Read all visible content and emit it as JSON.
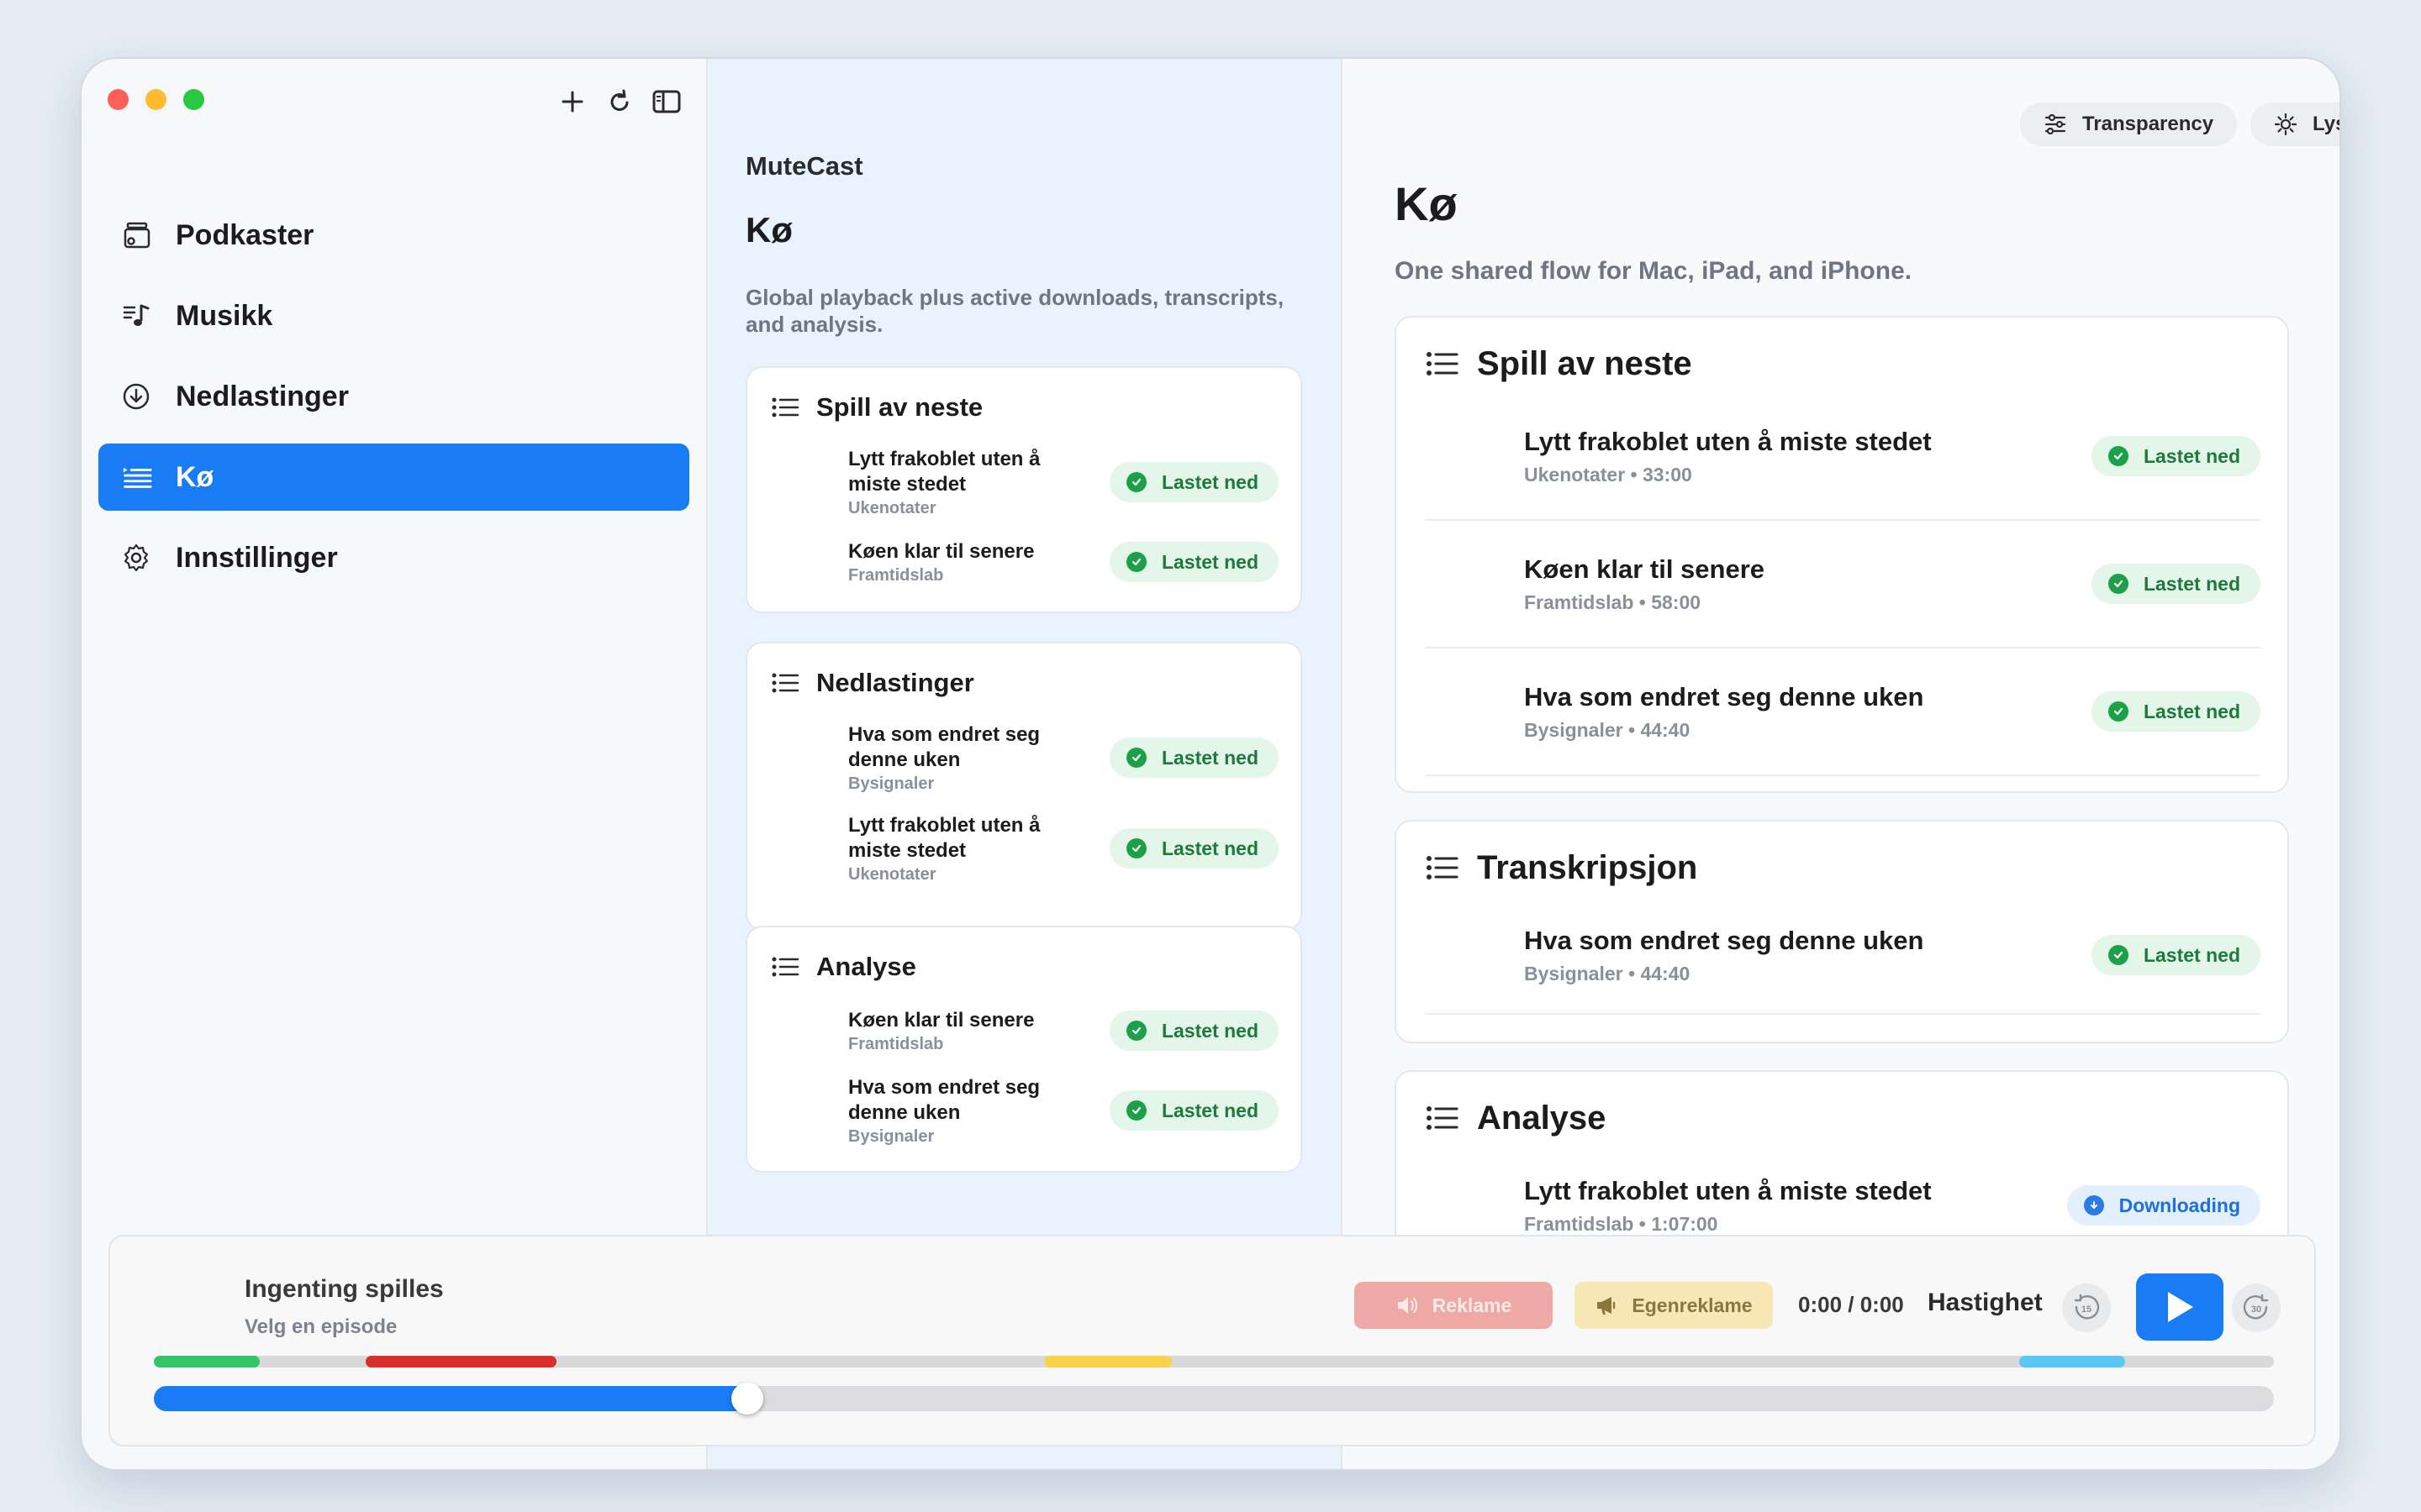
{
  "sidebar": {
    "items": [
      {
        "label": "Podkaster",
        "icon": "podcasts-icon"
      },
      {
        "label": "Musikk",
        "icon": "music-icon"
      },
      {
        "label": "Nedlastinger",
        "icon": "download-icon"
      },
      {
        "label": "Kø",
        "icon": "queue-icon",
        "active": true
      },
      {
        "label": "Innstillinger",
        "icon": "gear-icon"
      }
    ]
  },
  "middle": {
    "app_name": "MuteCast",
    "title": "Kø",
    "subtitle": "Global playback plus active downloads, transcripts, and analysis.",
    "sections": [
      {
        "title": "Spill av neste",
        "rows": [
          {
            "title": "Lytt frakoblet uten å miste stedet",
            "sub": "Ukenotater",
            "badge": "Lastet ned"
          },
          {
            "title": "Køen klar til senere",
            "sub": "Framtidslab",
            "badge": "Lastet ned"
          }
        ]
      },
      {
        "title": "Nedlastinger",
        "rows": [
          {
            "title": "Hva som endret seg denne uken",
            "sub": "Bysignaler",
            "badge": "Lastet ned"
          },
          {
            "title": "Lytt frakoblet uten å miste stedet",
            "sub": "Ukenotater",
            "badge": "Lastet ned"
          }
        ]
      },
      {
        "title": "Analyse",
        "rows": [
          {
            "title": "Køen klar til senere",
            "sub": "Framtidslab",
            "badge": "Lastet ned"
          },
          {
            "title": "Hva som endret seg denne uken",
            "sub": "Bysignaler",
            "badge": "Lastet ned"
          }
        ]
      }
    ]
  },
  "right": {
    "transparency_label": "Transparency",
    "theme_label": "Lyst",
    "title": "Kø",
    "subtitle": "One shared flow for Mac, iPad, and iPhone.",
    "sections": [
      {
        "title": "Spill av neste",
        "rows": [
          {
            "title": "Lytt frakoblet uten å miste stedet",
            "sub": "Ukenotater • 33:00",
            "badge": "Lastet ned"
          },
          {
            "title": "Køen klar til senere",
            "sub": "Framtidslab • 58:00",
            "badge": "Lastet ned"
          },
          {
            "title": "Hva som endret seg denne uken",
            "sub": "Bysignaler • 44:40",
            "badge": "Lastet ned"
          }
        ]
      },
      {
        "title": "Transkripsjon",
        "rows": [
          {
            "title": "Hva som endret seg denne uken",
            "sub": "Bysignaler • 44:40",
            "badge": "Lastet ned"
          }
        ]
      },
      {
        "title": "Analyse",
        "rows": [
          {
            "title": "Lytt frakoblet uten å miste stedet",
            "sub": "Framtidslab • 1:07:00",
            "badge": "Downloading"
          }
        ]
      }
    ]
  },
  "player": {
    "title": "Ingenting spilles",
    "subtitle": "Velg en episode",
    "ad_label": "Reklame",
    "self_promo_label": "Egenreklame",
    "time": "0:00 / 0:00",
    "speed_label": "Hastighet",
    "skip_back": "15",
    "skip_forward": "30",
    "progress_fraction": 0.28,
    "segments": [
      {
        "start": 0.0,
        "end": 0.05,
        "color": "#34c46a"
      },
      {
        "start": 0.1,
        "end": 0.19,
        "color": "#d6302a"
      },
      {
        "start": 0.42,
        "end": 0.48,
        "color": "#f7d24a"
      },
      {
        "start": 0.88,
        "end": 0.93,
        "color": "#5ac8f5"
      }
    ]
  },
  "colors": {
    "accent": "#1a7cf5",
    "success": "#1ea04a"
  }
}
